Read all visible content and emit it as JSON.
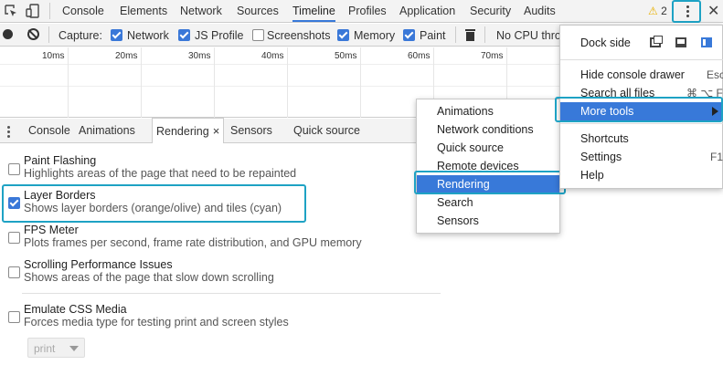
{
  "toolbar": {
    "tabs": [
      "Console",
      "Elements",
      "Network",
      "Sources",
      "Timeline",
      "Profiles",
      "Application",
      "Security",
      "Audits"
    ],
    "active_tab": "Timeline",
    "warning_count": "2",
    "warning_glyph": "⚠",
    "close_glyph": "✕"
  },
  "capture": {
    "label": "Capture:",
    "options": [
      {
        "label": "Network",
        "checked": true
      },
      {
        "label": "JS Profile",
        "checked": true
      },
      {
        "label": "Screenshots",
        "checked": false
      },
      {
        "label": "Memory",
        "checked": true
      },
      {
        "label": "Paint",
        "checked": true
      }
    ],
    "throttle": "No CPU thro"
  },
  "ruler": {
    "ticks": [
      "10ms",
      "20ms",
      "30ms",
      "40ms",
      "50ms",
      "60ms",
      "70ms"
    ]
  },
  "drawer": {
    "tabs": [
      "Console",
      "Animations",
      "Rendering",
      "Sensors",
      "Quick source"
    ],
    "selected": "Rendering",
    "close_glyph": "×"
  },
  "rendering": {
    "options": [
      {
        "title": "Paint Flashing",
        "desc": "Highlights areas of the page that need to be repainted",
        "checked": false
      },
      {
        "title": "Layer Borders",
        "desc": "Shows layer borders (orange/olive) and tiles (cyan)",
        "checked": true
      },
      {
        "title": "FPS Meter",
        "desc": "Plots frames per second, frame rate distribution, and GPU memory",
        "checked": false
      },
      {
        "title": "Scrolling Performance Issues",
        "desc": "Shows areas of the page that slow down scrolling",
        "checked": false
      },
      {
        "title": "Emulate CSS Media",
        "desc": "Forces media type for testing print and screen styles",
        "checked": false
      }
    ],
    "media_select": "print"
  },
  "more_tools_menu": {
    "items": [
      "Animations",
      "Network conditions",
      "Quick source",
      "Remote devices",
      "Rendering",
      "Search",
      "Sensors"
    ],
    "highlighted": "Rendering"
  },
  "main_menu": {
    "dock_side_label": "Dock side",
    "items": [
      {
        "label": "Hide console drawer",
        "shortcut": "Esc"
      },
      {
        "label": "Search all files",
        "shortcut": "⌘ ⌥ F"
      },
      {
        "label": "More tools",
        "shortcut": ""
      },
      {
        "label": "Shortcuts",
        "shortcut": ""
      },
      {
        "label": "Settings",
        "shortcut": "F1"
      },
      {
        "label": "Help",
        "shortcut": ""
      }
    ],
    "highlighted": "More tools"
  },
  "colors": {
    "accent": "#3879d9",
    "highlight_outline": "#1ea2c4"
  }
}
